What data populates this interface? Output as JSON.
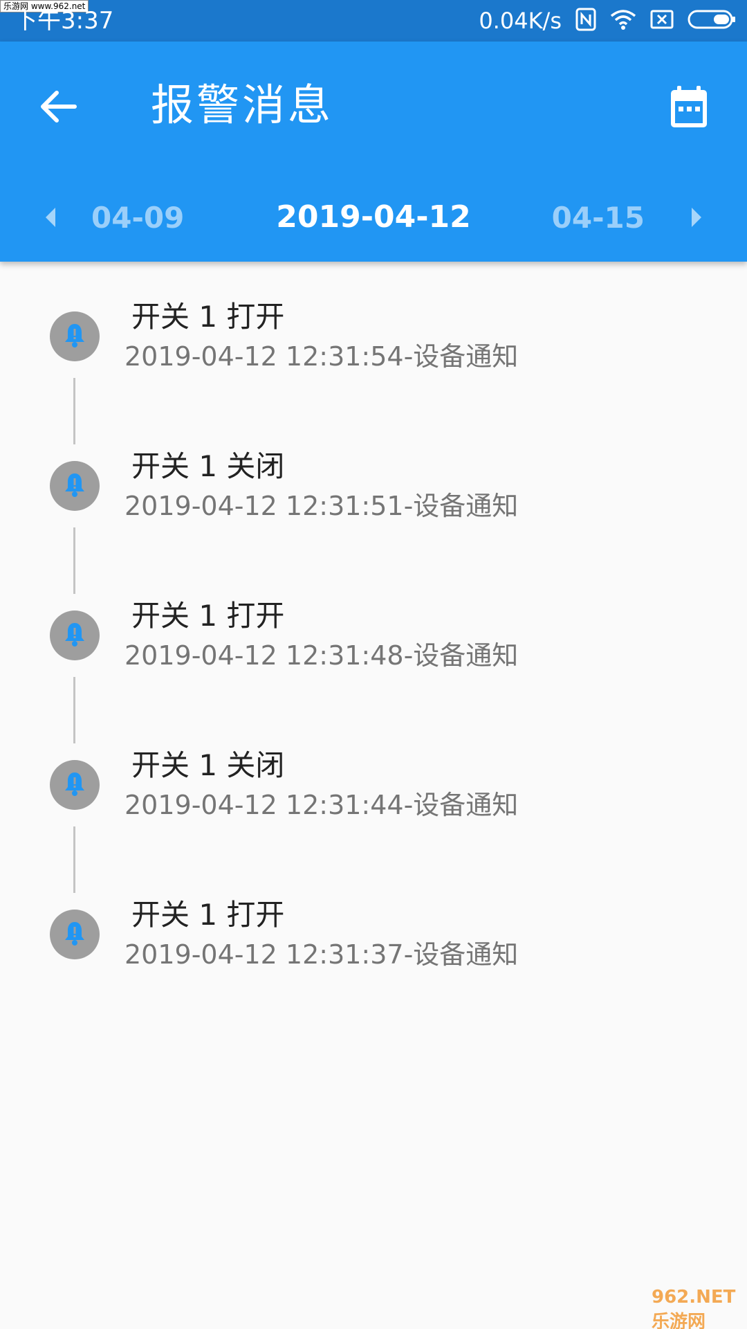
{
  "status_bar": {
    "time": "下午3:37",
    "net_speed": "0.04K/s",
    "watermark": "乐游网 www.962.net",
    "icons": [
      "nfc-icon",
      "wifi-icon",
      "sim-off-icon",
      "battery-icon"
    ]
  },
  "app_bar": {
    "title": "报警消息",
    "back_icon": "arrow-back-icon",
    "calendar_icon": "calendar-icon"
  },
  "date_nav": {
    "prev": "04-09",
    "current": "2019-04-12",
    "next": "04-15"
  },
  "colors": {
    "status_bar": "#1b78cc",
    "app_bar": "#2196f3",
    "bell": "#2196f3",
    "circle": "#9e9e9e"
  },
  "alarms": [
    {
      "title": "开关 1 打开",
      "detail": "2019-04-12 12:31:54-设备通知"
    },
    {
      "title": "开关 1 关闭",
      "detail": "2019-04-12 12:31:51-设备通知"
    },
    {
      "title": "开关 1 打开",
      "detail": "2019-04-12 12:31:48-设备通知"
    },
    {
      "title": "开关 1 关闭",
      "detail": "2019-04-12 12:31:44-设备通知"
    },
    {
      "title": "开关 1 打开",
      "detail": "2019-04-12 12:31:37-设备通知"
    }
  ],
  "watermark_bottom": "962.NET 乐游网"
}
